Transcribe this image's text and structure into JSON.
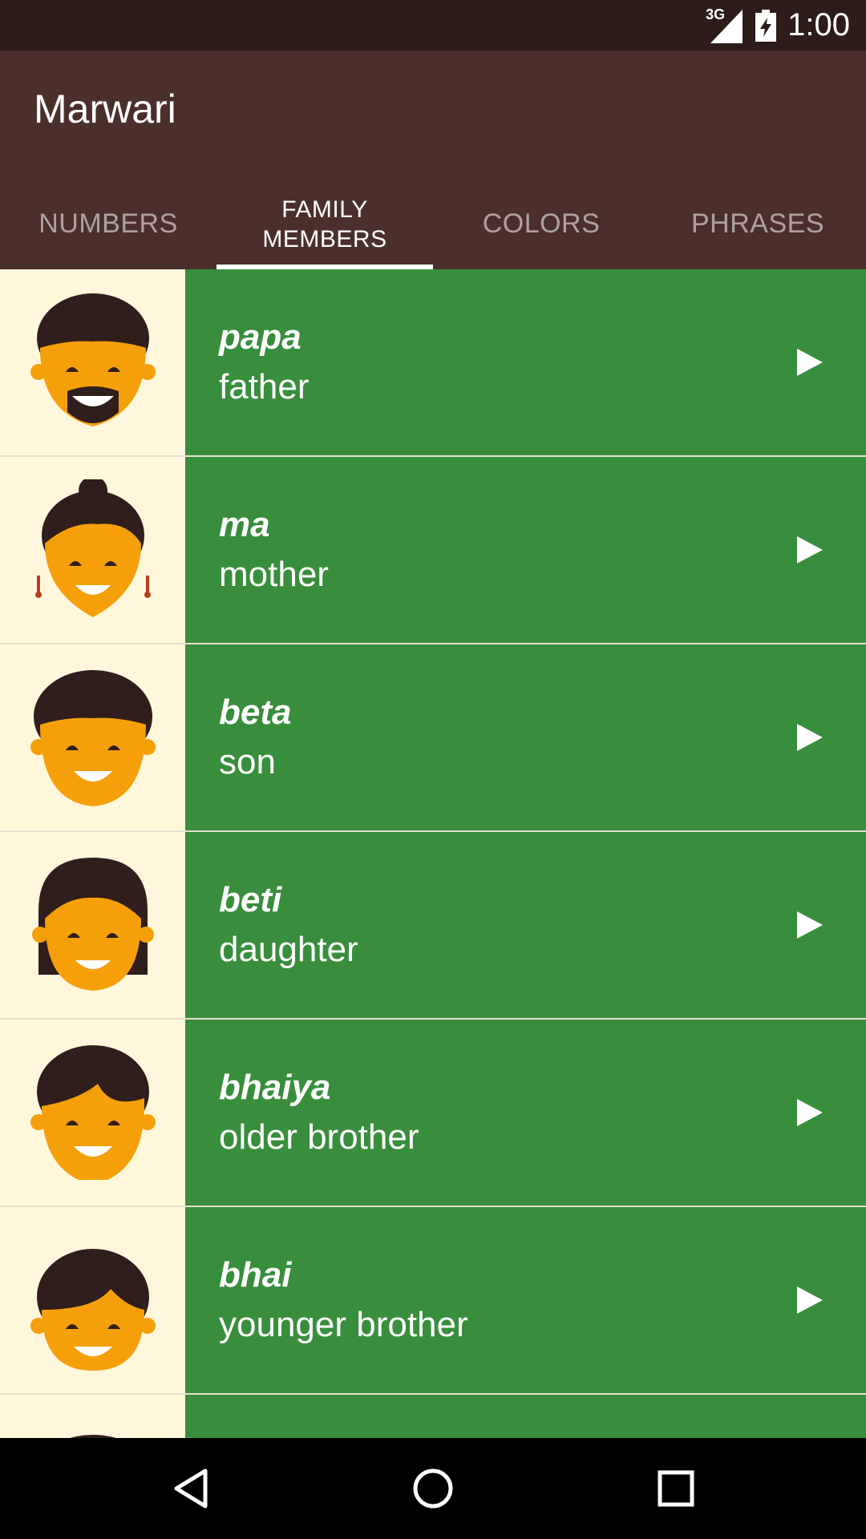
{
  "status_bar": {
    "network": "3G",
    "time": "1:00"
  },
  "app": {
    "title": "Marwari"
  },
  "tabs": [
    {
      "label": "NUMBERS",
      "active": false
    },
    {
      "label": "FAMILY MEMBERS",
      "active": true
    },
    {
      "label": "COLORS",
      "active": false
    },
    {
      "label": "PHRASES",
      "active": false
    }
  ],
  "words": [
    {
      "marwari": "papa",
      "english": "father",
      "icon": "father-face-icon"
    },
    {
      "marwari": "ma",
      "english": "mother",
      "icon": "mother-face-icon"
    },
    {
      "marwari": "beta",
      "english": "son",
      "icon": "son-face-icon"
    },
    {
      "marwari": "beti",
      "english": "daughter",
      "icon": "daughter-face-icon"
    },
    {
      "marwari": "bhaiya",
      "english": "older brother",
      "icon": "older-brother-face-icon"
    },
    {
      "marwari": "bhai",
      "english": "younger brother",
      "icon": "younger-brother-face-icon"
    }
  ],
  "colors": {
    "status_bar": "#2e1c1a",
    "app_bar": "#4a2f2b",
    "item_background": "#388e3c",
    "thumb_background": "#fef7dc",
    "skin": "#f5a00a",
    "hair": "#2f1e1b"
  },
  "nav": {
    "back": "back-icon",
    "home": "home-icon",
    "recents": "recents-icon"
  }
}
